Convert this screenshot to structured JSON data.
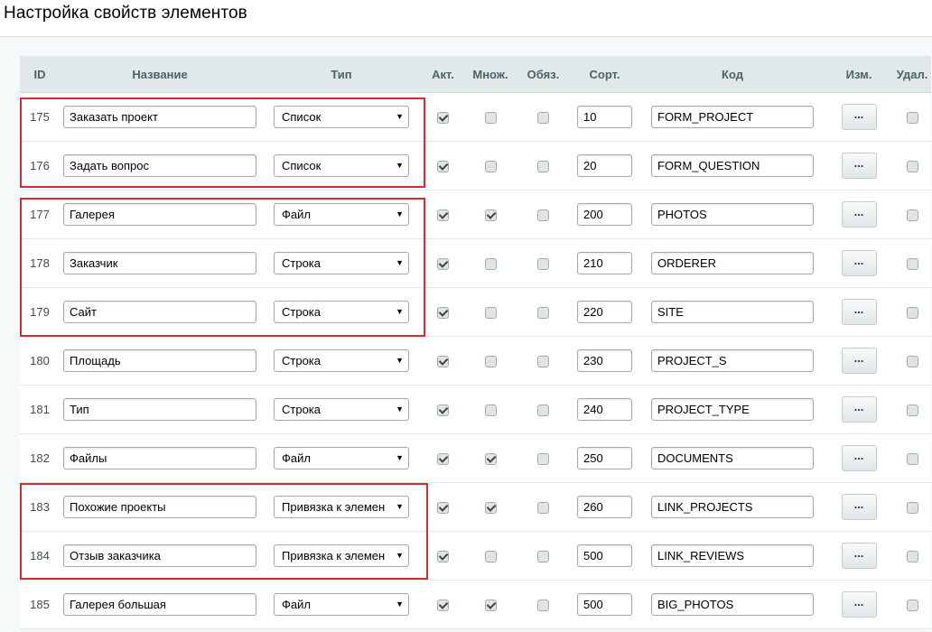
{
  "page": {
    "title": "Настройка свойств элементов"
  },
  "columns": {
    "id": "ID",
    "name": "Название",
    "type": "Тип",
    "active": "Акт.",
    "multiple": "Множ.",
    "required": "Обяз.",
    "sort": "Сорт.",
    "code": "Код",
    "edit": "Изм.",
    "delete": "Удал."
  },
  "rows": [
    {
      "id": "175",
      "name": "Заказать проект",
      "type": "Список",
      "active": true,
      "multiple": false,
      "required": false,
      "sort": "10",
      "code": "FORM_PROJECT",
      "edit": "...",
      "delete": false
    },
    {
      "id": "176",
      "name": "Задать вопрос",
      "type": "Список",
      "active": true,
      "multiple": false,
      "required": false,
      "sort": "20",
      "code": "FORM_QUESTION",
      "edit": "...",
      "delete": false
    },
    {
      "id": "177",
      "name": "Галерея",
      "type": "Файл",
      "active": true,
      "multiple": true,
      "required": false,
      "sort": "200",
      "code": "PHOTOS",
      "edit": "...",
      "delete": false
    },
    {
      "id": "178",
      "name": "Заказчик",
      "type": "Строка",
      "active": true,
      "multiple": false,
      "required": false,
      "sort": "210",
      "code": "ORDERER",
      "edit": "...",
      "delete": false
    },
    {
      "id": "179",
      "name": "Сайт",
      "type": "Строка",
      "active": true,
      "multiple": false,
      "required": false,
      "sort": "220",
      "code": "SITE",
      "edit": "...",
      "delete": false
    },
    {
      "id": "180",
      "name": "Площадь",
      "type": "Строка",
      "active": true,
      "multiple": false,
      "required": false,
      "sort": "230",
      "code": "PROJECT_S",
      "edit": "...",
      "delete": false
    },
    {
      "id": "181",
      "name": "Тип",
      "type": "Строка",
      "active": true,
      "multiple": false,
      "required": false,
      "sort": "240",
      "code": "PROJECT_TYPE",
      "edit": "...",
      "delete": false
    },
    {
      "id": "182",
      "name": "Файлы",
      "type": "Файл",
      "active": true,
      "multiple": true,
      "required": false,
      "sort": "250",
      "code": "DOCUMENTS",
      "edit": "...",
      "delete": false
    },
    {
      "id": "183",
      "name": "Похожие проекты",
      "type": "Привязка к элемен",
      "active": true,
      "multiple": true,
      "required": false,
      "sort": "260",
      "code": "LINK_PROJECTS",
      "edit": "...",
      "delete": false
    },
    {
      "id": "184",
      "name": "Отзыв заказчика",
      "type": "Привязка к элемен",
      "active": true,
      "multiple": false,
      "required": false,
      "sort": "500",
      "code": "LINK_REVIEWS",
      "edit": "...",
      "delete": false
    },
    {
      "id": "185",
      "name": "Галерея большая",
      "type": "Файл",
      "active": true,
      "multiple": true,
      "required": false,
      "sort": "500",
      "code": "BIG_PHOTOS",
      "edit": "...",
      "delete": false
    }
  ],
  "dropdown_arrow": "▼",
  "icons": {
    "dropdown": "triangle-down-icon",
    "checkbox": "checkmark-icon"
  },
  "colors": {
    "highlight": "#d52b30",
    "header_bg": "#e0e8ea",
    "header_text": "#4b6267"
  }
}
